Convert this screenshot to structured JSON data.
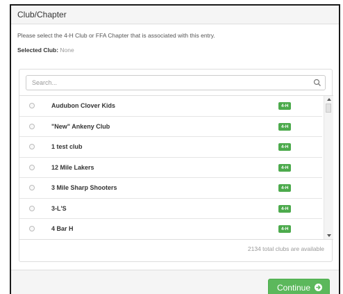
{
  "header": {
    "title": "Club/Chapter"
  },
  "instructions": "Please select the 4-H Club or FFA Chapter that is associated with this entry.",
  "selected": {
    "label": "Selected Club:",
    "value": "None"
  },
  "search": {
    "placeholder": "Search..."
  },
  "clubs": [
    {
      "name": "Audubon Clover Kids",
      "badge": "4-H"
    },
    {
      "name": "\"New\" Ankeny Club",
      "badge": "4-H"
    },
    {
      "name": "1 test club",
      "badge": "4-H"
    },
    {
      "name": "12 Mile Lakers",
      "badge": "4-H"
    },
    {
      "name": "3 Mile Sharp Shooters",
      "badge": "4-H"
    },
    {
      "name": "3-L'S",
      "badge": "4-H"
    },
    {
      "name": "4 Bar H",
      "badge": "4-H"
    }
  ],
  "count_text": "2134 total clubs are available",
  "footer": {
    "continue_label": "Continue"
  },
  "colors": {
    "accent": "#5cb85c",
    "badge": "#4caa4c"
  }
}
